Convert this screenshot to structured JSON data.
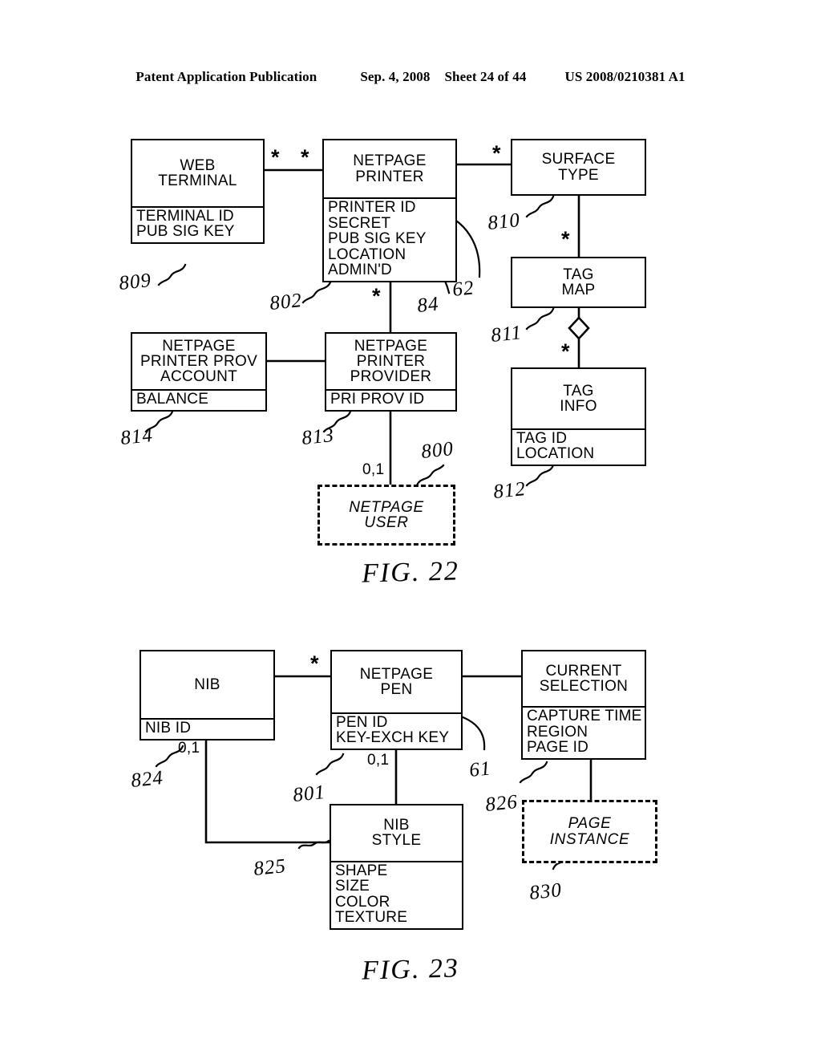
{
  "header": {
    "publication": "Patent Application Publication",
    "date": "Sep. 4, 2008",
    "sheet": "Sheet 24 of 44",
    "number": "US 2008/0210381 A1"
  },
  "figures": [
    {
      "caption": "FIG. 22",
      "entities": [
        {
          "id": "web-terminal",
          "title": "WEB\nTERMINAL",
          "attrs": "TERMINAL ID\nPUB SIG KEY"
        },
        {
          "id": "netpage-printer",
          "title": "NETPAGE\nPRINTER",
          "attrs": "PRINTER ID\nSECRET\nPUB SIG KEY\nLOCATION\nADMIN'D"
        },
        {
          "id": "surface-type",
          "title": "SURFACE\nTYPE",
          "attrs": ""
        },
        {
          "id": "tag-map",
          "title": "TAG\nMAP",
          "attrs": ""
        },
        {
          "id": "tag-info",
          "title": "TAG\nINFO",
          "attrs": "TAG ID\nLOCATION"
        },
        {
          "id": "printer-prov-account",
          "title": "NETPAGE\nPRINTER PROV\nACCOUNT",
          "attrs": "BALANCE"
        },
        {
          "id": "printer-provider",
          "title": "NETPAGE\nPRINTER\nPROVIDER",
          "attrs": "PRI PROV ID"
        },
        {
          "id": "netpage-user",
          "title": "NETPAGE\nUSER",
          "attrs": ""
        }
      ],
      "refs": [
        "809",
        "802",
        "84",
        "62",
        "810",
        "811",
        "812",
        "814",
        "813",
        "800"
      ],
      "cardinalities": [
        "*",
        "*",
        "*",
        "*",
        "*",
        "*",
        "*",
        "0,1"
      ]
    },
    {
      "caption": "FIG. 23",
      "entities": [
        {
          "id": "nib",
          "title": "NIB",
          "attrs": "NIB ID"
        },
        {
          "id": "netpage-pen",
          "title": "NETPAGE\nPEN",
          "attrs": "PEN ID\nKEY-EXCH KEY"
        },
        {
          "id": "current-selection",
          "title": "CURRENT\nSELECTION",
          "attrs": "CAPTURE TIME\nREGION\nPAGE ID"
        },
        {
          "id": "nib-style",
          "title": "NIB\nSTYLE",
          "attrs": "SHAPE\nSIZE\nCOLOR\nTEXTURE"
        },
        {
          "id": "page-instance",
          "title": "PAGE\nINSTANCE",
          "attrs": ""
        }
      ],
      "refs": [
        "824",
        "801",
        "61",
        "826",
        "825",
        "830"
      ],
      "cardinalities": [
        "*",
        "0,1",
        "0,1"
      ]
    }
  ],
  "fig22": {
    "web_terminal_title": "WEB\nTERMINAL",
    "web_terminal_attrs": "TERMINAL ID\nPUB SIG KEY",
    "netpage_printer_title": "NETPAGE\nPRINTER",
    "netpage_printer_attrs": "PRINTER ID\nSECRET\nPUB SIG KEY\nLOCATION\nADMIN'D",
    "surface_type_title": "SURFACE\nTYPE",
    "tag_map_title": "TAG\nMAP",
    "tag_info_title": "TAG\nINFO",
    "tag_info_attrs": "TAG ID\nLOCATION",
    "prov_account_title": "NETPAGE\nPRINTER PROV\nACCOUNT",
    "prov_account_attrs": "BALANCE",
    "printer_provider_title": "NETPAGE\nPRINTER\nPROVIDER",
    "printer_provider_attrs": "PRI PROV ID",
    "netpage_user_title": "NETPAGE\nUSER",
    "ref_809": "809",
    "ref_802": "802",
    "ref_84": "84",
    "ref_62": "62",
    "ref_810": "810",
    "ref_811": "811",
    "ref_812": "812",
    "ref_814": "814",
    "ref_813": "813",
    "ref_800": "800",
    "star_wt_np_left": "*",
    "star_wt_np_right": "*",
    "star_np_st": "*",
    "star_st_tm": "*",
    "star_tm_ti": "*",
    "star_np_pp": "*",
    "star_pp_attr": "*",
    "card_user": "0,1",
    "caption": "FIG. 22"
  },
  "fig23": {
    "nib_title": "NIB",
    "nib_attrs": "NIB ID",
    "pen_title": "NETPAGE\nPEN",
    "pen_attrs": "PEN ID\nKEY-EXCH KEY",
    "selection_title": "CURRENT\nSELECTION",
    "selection_attrs": "CAPTURE TIME\nREGION\nPAGE ID",
    "nib_style_title": "NIB\nSTYLE",
    "nib_style_attrs": "SHAPE\nSIZE\nCOLOR\nTEXTURE",
    "page_instance_title": "PAGE\nINSTANCE",
    "ref_824": "824",
    "ref_801": "801",
    "ref_61": "61",
    "ref_826": "826",
    "ref_825": "825",
    "ref_830": "830",
    "star_nib_pen": "*",
    "card_nib": "0,1",
    "card_pen": "0,1",
    "caption": "FIG. 23"
  }
}
